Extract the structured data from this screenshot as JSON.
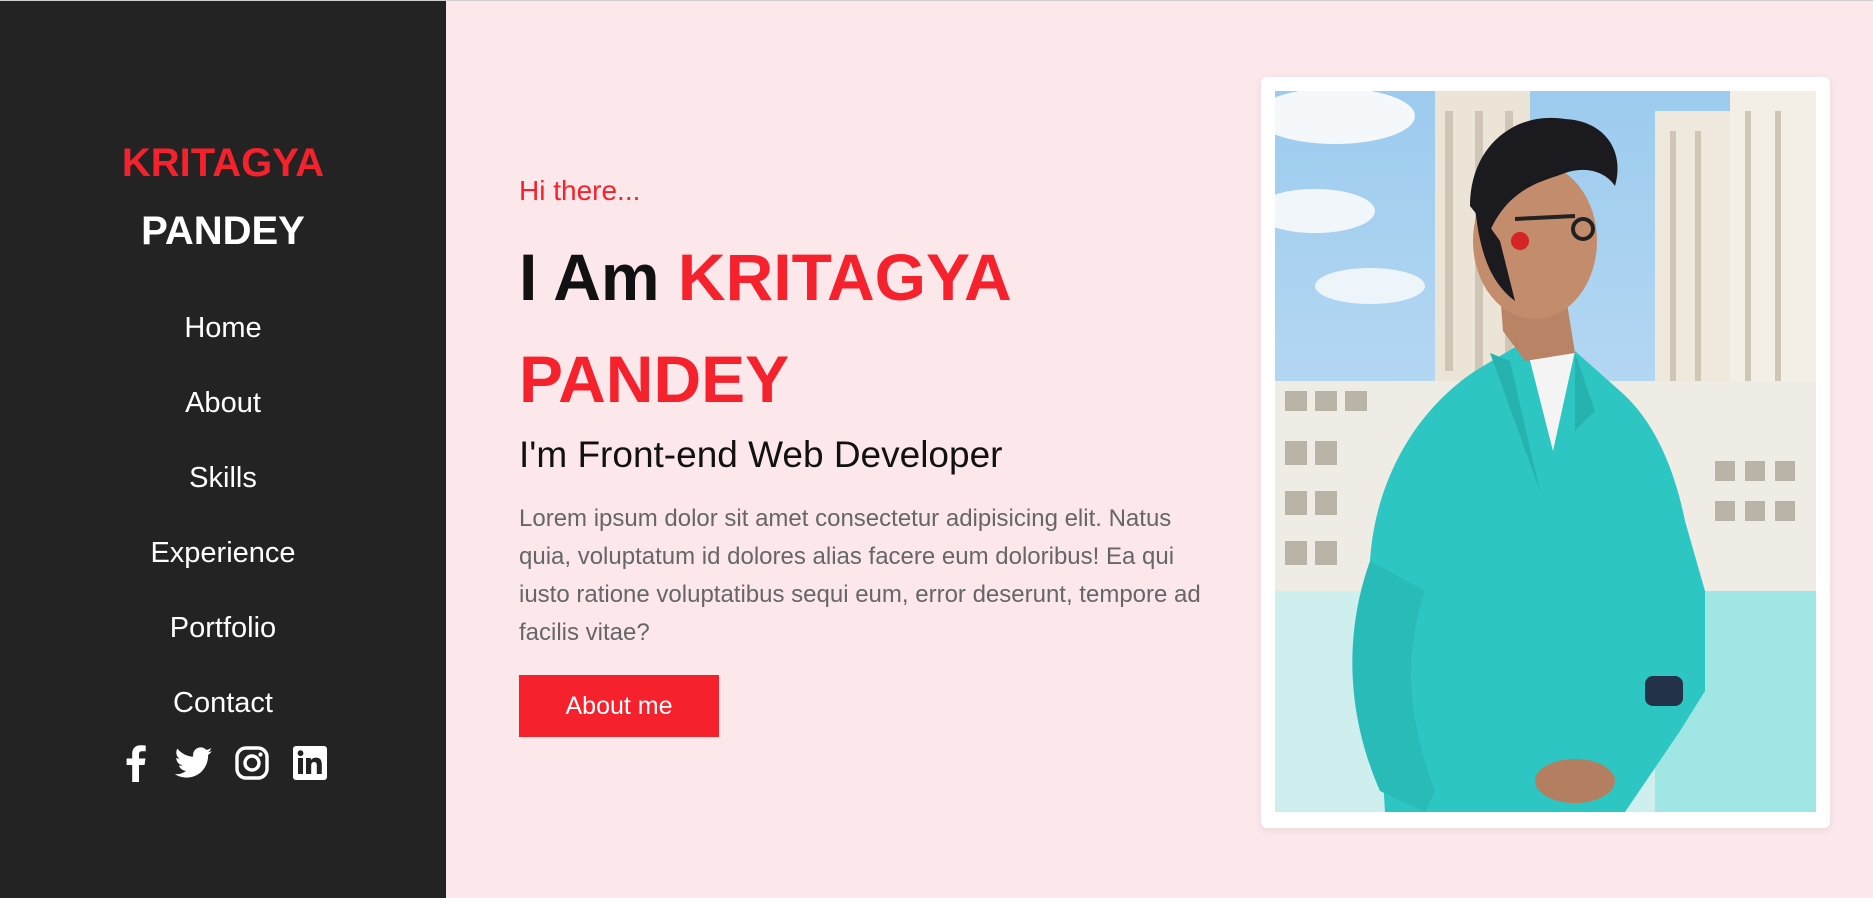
{
  "sidebar": {
    "logo_first": "KRITAGYA",
    "logo_last": "PANDEY",
    "nav": [
      "Home",
      "About",
      "Skills",
      "Experience",
      "Portfolio",
      "Contact"
    ],
    "socials": [
      "facebook-icon",
      "twitter-icon",
      "instagram-icon",
      "linkedin-icon"
    ]
  },
  "hero": {
    "greeting": "Hi there...",
    "title_prefix": "I Am ",
    "title_name_first": "KRITAGYA",
    "title_name_last": "PANDEY",
    "role": "I'm Front-end Web Developer",
    "description": "Lorem ipsum dolor sit amet consectetur adipisicing elit. Natus quia, voluptatum id dolores alias facere eum doloribus! Ea qui iusto ratione voluptatibus sequi eum, error deserunt, tempore ad facilis vitae?",
    "button_label": "About me"
  },
  "colors": {
    "accent": "#f5222d",
    "sidebar_bg": "#232323",
    "page_bg": "#fce8ea"
  }
}
